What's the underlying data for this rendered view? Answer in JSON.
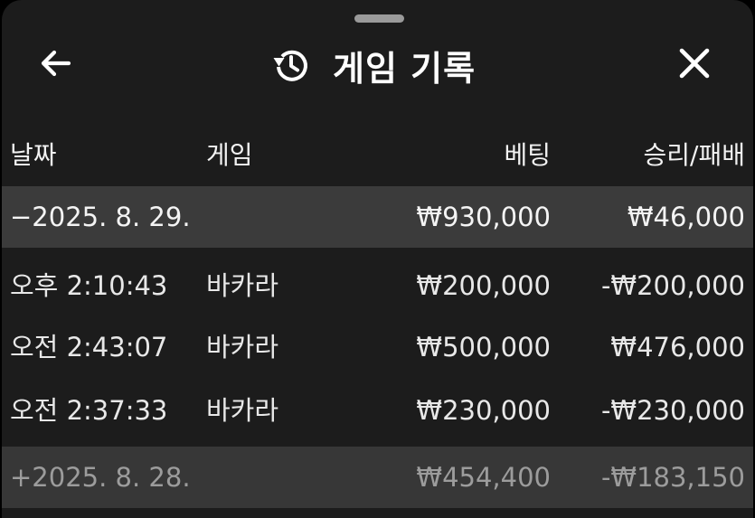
{
  "header": {
    "title": "게임 기록",
    "back_icon": "arrow-left-icon",
    "title_icon": "history-icon",
    "close_icon": "close-icon"
  },
  "columns": {
    "date": "날짜",
    "game": "게임",
    "bet": "베팅",
    "result": "승리/패배"
  },
  "groups": [
    {
      "date": "−2025. 8. 29.",
      "bet": "₩930,000",
      "result": "₩46,000",
      "expanded": true,
      "rows": [
        {
          "time": "오후 2:10:43",
          "game": "바카라",
          "bet": "₩200,000",
          "result": "-₩200,000"
        },
        {
          "time": "오전 2:43:07",
          "game": "바카라",
          "bet": "₩500,000",
          "result": "₩476,000"
        },
        {
          "time": "오전 2:37:33",
          "game": "바카라",
          "bet": "₩230,000",
          "result": "-₩230,000"
        }
      ]
    },
    {
      "date": "+2025. 8. 28.",
      "bet": "₩454,400",
      "result": "-₩183,150",
      "expanded": false,
      "rows": []
    }
  ],
  "colors": {
    "sheet_background": "#1c1c1c",
    "expanded_group_background": "#3b3b3b",
    "collapsed_group_background": "#373737",
    "collapsed_group_text": "#9c9c9c",
    "primary_text": "#f2f2f2"
  }
}
